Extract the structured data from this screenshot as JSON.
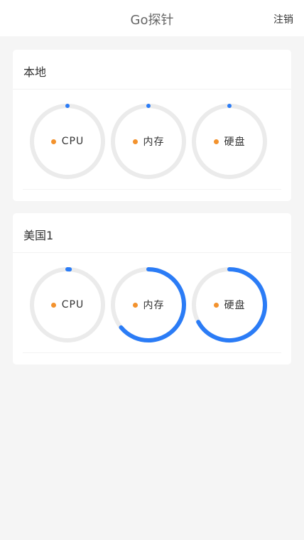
{
  "header": {
    "title": "Go探针",
    "logout_label": "注销"
  },
  "colors": {
    "track": "#ebebeb",
    "progress": "#2b7cf6",
    "dot": "#f3922d"
  },
  "servers": [
    {
      "name": "本地",
      "gauges": [
        {
          "label": "CPU",
          "percent": 0
        },
        {
          "label": "内存",
          "percent": 0
        },
        {
          "label": "硬盘",
          "percent": 0
        }
      ]
    },
    {
      "name": "美国1",
      "gauges": [
        {
          "label": "CPU",
          "percent": 1
        },
        {
          "label": "内存",
          "percent": 64
        },
        {
          "label": "硬盘",
          "percent": 67
        }
      ]
    }
  ]
}
